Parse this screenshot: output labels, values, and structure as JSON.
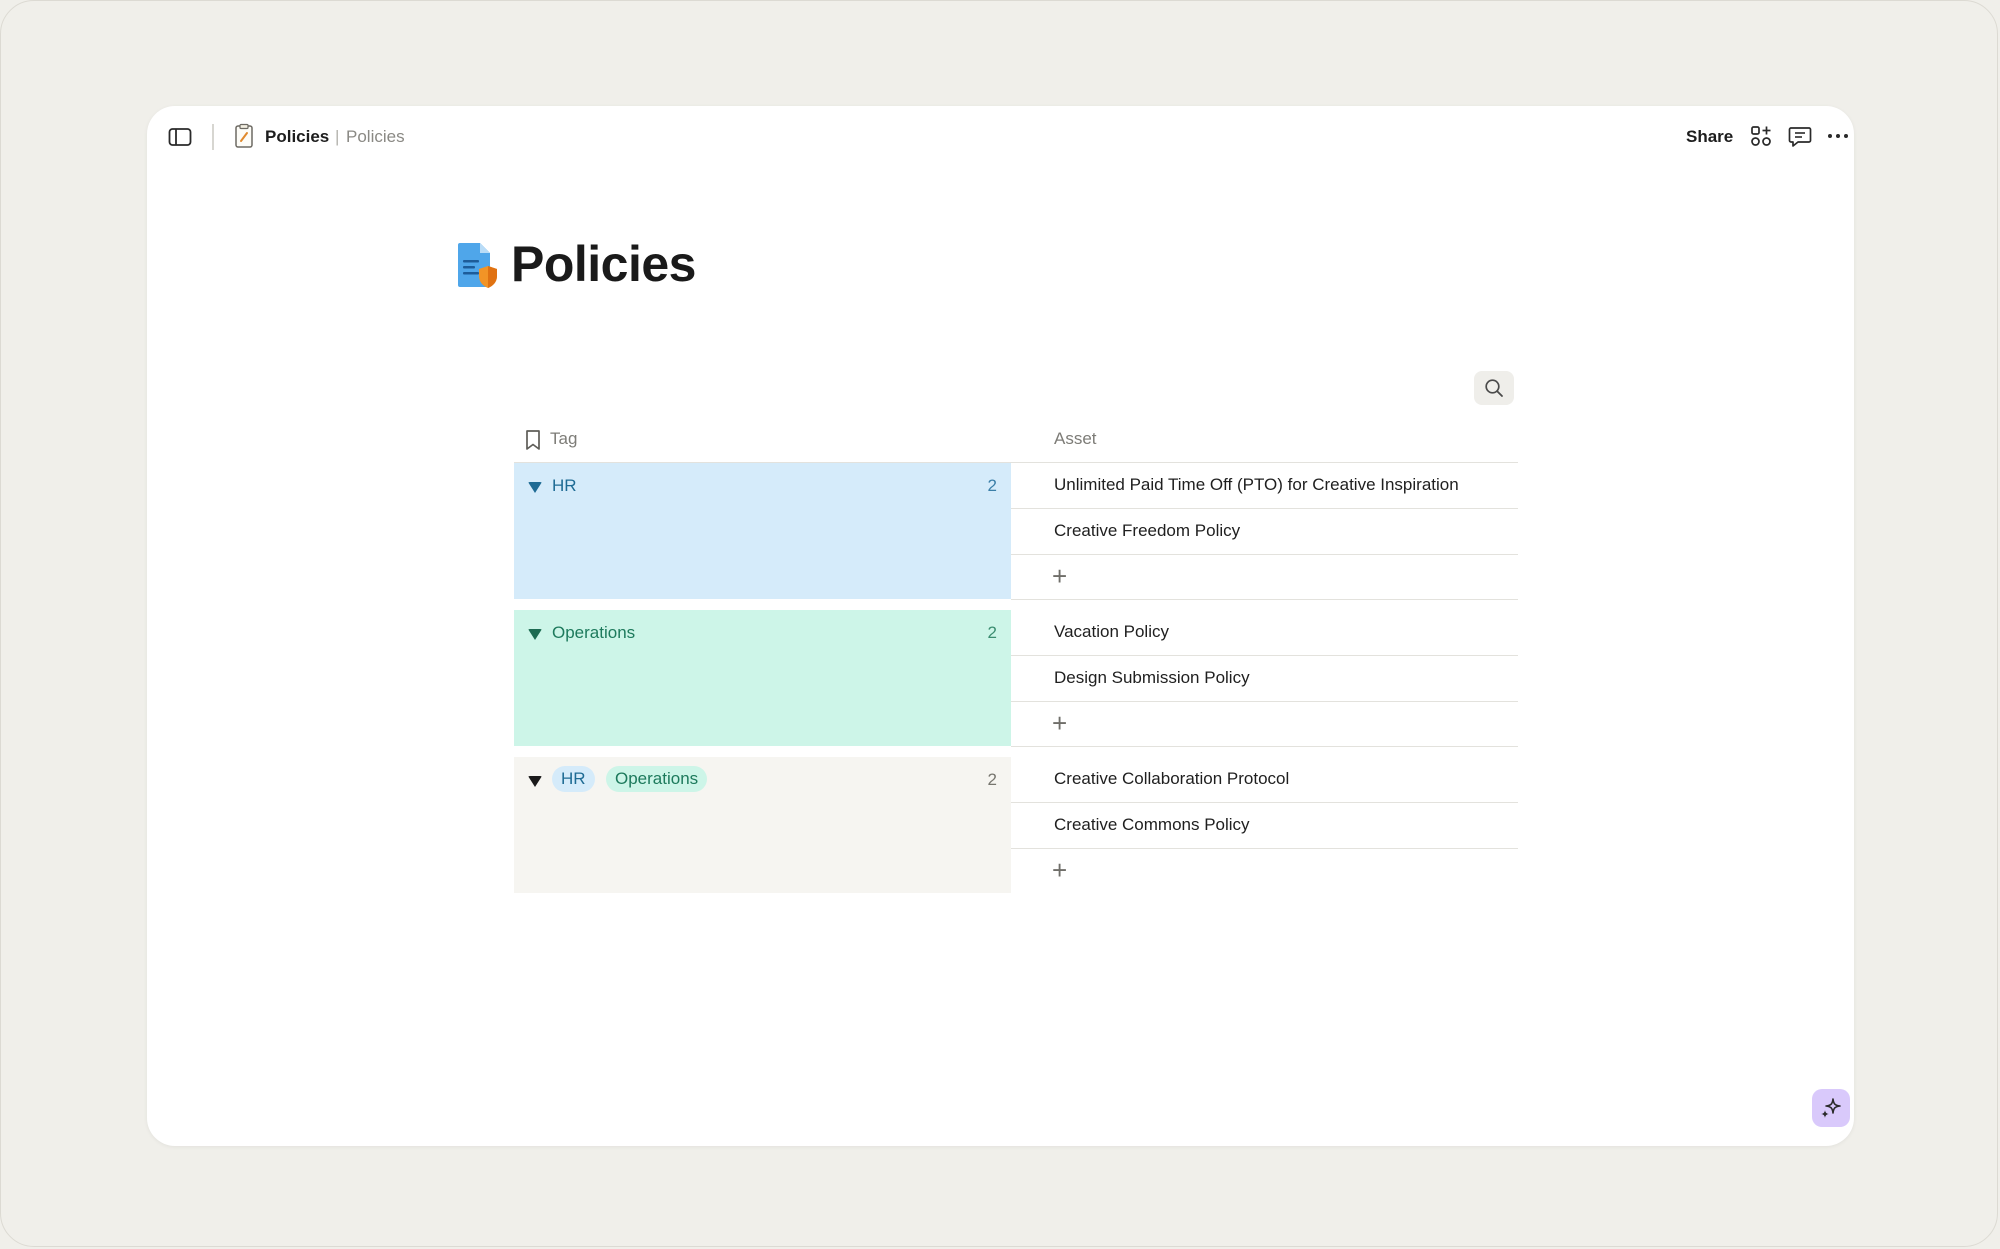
{
  "header": {
    "breadcrumb_title": "Policies",
    "breadcrumb_separator": "|",
    "breadcrumb_sub": "Policies",
    "share_label": "Share",
    "icons": [
      "sidebar-toggle-icon",
      "document-icon",
      "apps-icon",
      "comment-icon",
      "more-icon"
    ]
  },
  "page": {
    "title": "Policies",
    "icon": "policy-document-icon"
  },
  "table": {
    "headers": {
      "tag": "Tag",
      "asset": "Asset"
    },
    "add_symbol": "+",
    "groups": [
      {
        "label": "HR",
        "count": "2",
        "assets": [
          "Unlimited Paid Time Off (PTO) for Creative Inspiration",
          "Creative Freedom Policy"
        ]
      },
      {
        "label": "Operations",
        "count": "2",
        "assets": [
          "Vacation Policy",
          "Design Submission Policy"
        ]
      },
      {
        "tags": [
          "HR",
          "Operations"
        ],
        "count": "2",
        "assets": [
          "Creative Collaboration Protocol",
          "Creative Commons Policy"
        ]
      }
    ]
  },
  "colors": {
    "background": "#f0efea",
    "hr_fill": "#d5ebfa",
    "hr_text": "#1e6b94",
    "ops_fill": "#cdf5e8",
    "ops_text": "#1d7a5c",
    "mixed_fill": "#f6f5f1",
    "ai_button": "#d9c9fb"
  }
}
